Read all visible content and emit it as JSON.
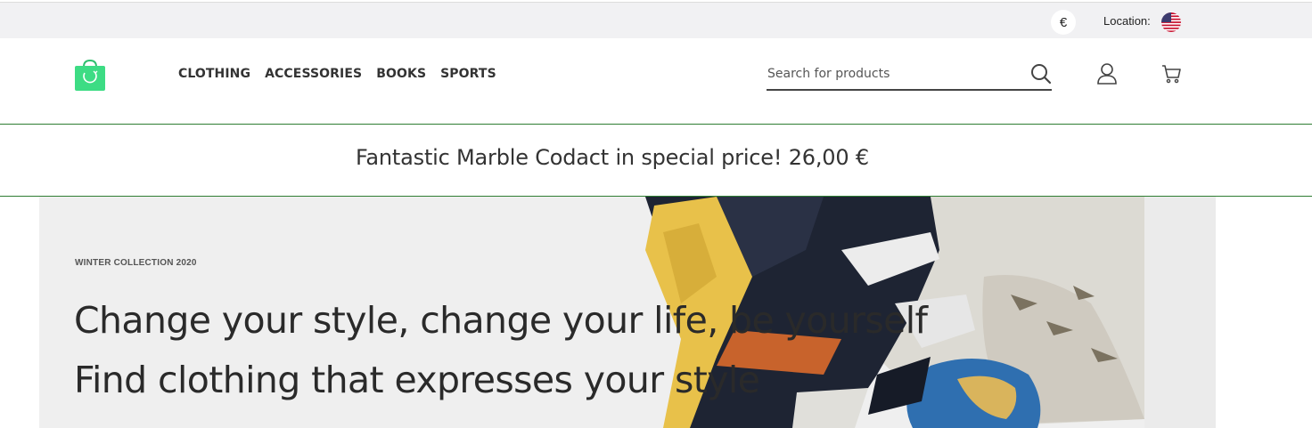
{
  "topbar": {
    "currency_symbol": "€",
    "location_label": "Location:",
    "flag_icon": "us-flag-icon"
  },
  "header": {
    "logo_icon": "shopping-bag-icon",
    "brand_color": "#3ddc84",
    "nav": [
      {
        "label": "CLOTHING"
      },
      {
        "label": "ACCESSORIES"
      },
      {
        "label": "BOOKS"
      },
      {
        "label": "SPORTS"
      }
    ],
    "search": {
      "placeholder": "Search for products",
      "value": ""
    },
    "icons": [
      "search-icon",
      "user-icon",
      "cart-icon"
    ],
    "divider_color": "#2e7d32"
  },
  "promo": {
    "text": "Fantastic Marble Codact in special price! 26,00 €"
  },
  "hero": {
    "tag": "WINTER COLLECTION 2020",
    "line1": "Change your style, change your life, be yourself",
    "line2": "Find clothing that expresses your style"
  }
}
